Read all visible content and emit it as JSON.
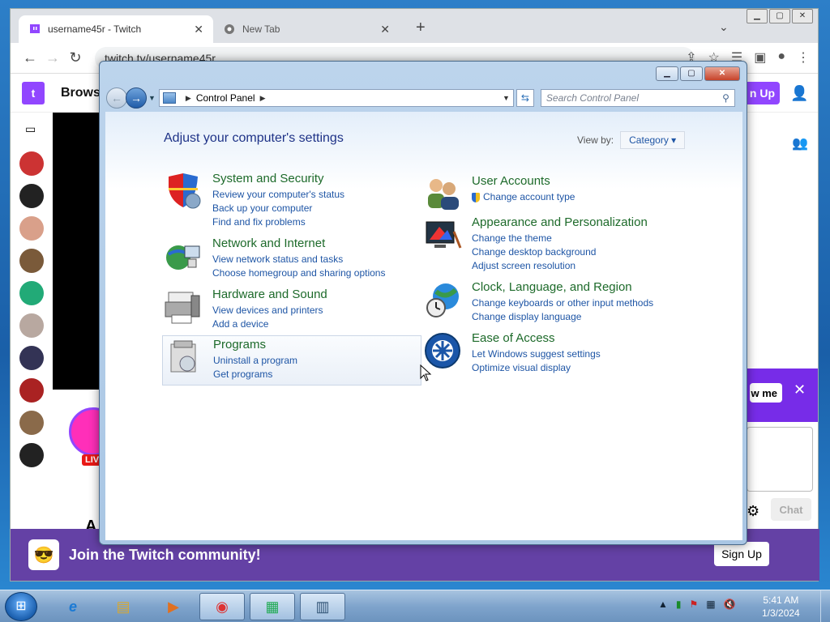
{
  "chrome": {
    "tabs": [
      {
        "title": "username45r - Twitch",
        "close": "✕"
      },
      {
        "title": "New Tab",
        "close": "✕"
      }
    ],
    "new_tab": "+",
    "tab_dropdown": "⌄",
    "window_controls": {
      "minimize": "▁",
      "maximize": "▢",
      "close": "✕"
    },
    "url": "twitch.tv/username45r",
    "toolbar": {
      "back": "←",
      "forward": "→",
      "reload": "↻",
      "share": "⇪",
      "star": "☆",
      "reading": "☰",
      "sidebar": "▣",
      "profile": "●",
      "menu": "⋮"
    }
  },
  "twitch": {
    "logo": "t",
    "browse": "Browse",
    "sign_up_top": "n Up",
    "follow_btn": "w me",
    "close_banner": "✕",
    "live_badge": "LIV",
    "chat_button": "Chat",
    "partial_text": "A",
    "join_text": "Join the Twitch community!",
    "sign_up_bottom": "Sign Up"
  },
  "control_panel": {
    "window_controls": {
      "minimize": "▁",
      "maximize": "▢",
      "close": "✕"
    },
    "address_label": "Control Panel",
    "search_placeholder": "Search Control Panel",
    "heading": "Adjust your computer's settings",
    "view_by_label": "View by:",
    "view_by_value": "Category",
    "categories_left": [
      {
        "title": "System and Security",
        "links": [
          "Review your computer's status",
          "Back up your computer",
          "Find and fix problems"
        ],
        "icon": "shield-icon"
      },
      {
        "title": "Network and Internet",
        "links": [
          "View network status and tasks",
          "Choose homegroup and sharing options"
        ],
        "icon": "network-globe-icon"
      },
      {
        "title": "Hardware and Sound",
        "links": [
          "View devices and printers",
          "Add a device"
        ],
        "icon": "printer-icon"
      },
      {
        "title": "Programs",
        "links": [
          "Uninstall a program",
          "Get programs"
        ],
        "icon": "programs-box-icon"
      }
    ],
    "categories_right": [
      {
        "title": "User Accounts",
        "links": [
          "Change account type"
        ],
        "icon": "users-icon"
      },
      {
        "title": "Appearance and Personalization",
        "links": [
          "Change the theme",
          "Change desktop background",
          "Adjust screen resolution"
        ],
        "icon": "monitor-paint-icon"
      },
      {
        "title": "Clock, Language, and Region",
        "links": [
          "Change keyboards or other input methods",
          "Change display language"
        ],
        "icon": "clock-globe-icon"
      },
      {
        "title": "Ease of Access",
        "links": [
          "Let Windows suggest settings",
          "Optimize visual display"
        ],
        "icon": "ease-of-access-icon"
      }
    ]
  },
  "taskbar": {
    "start": "⊞",
    "apps": [
      {
        "name": "internet-explorer",
        "glyph": "e"
      },
      {
        "name": "file-explorer",
        "glyph": "▤"
      },
      {
        "name": "media-player",
        "glyph": "▶"
      },
      {
        "name": "chrome",
        "glyph": "◉"
      },
      {
        "name": "task-manager",
        "glyph": "▦"
      },
      {
        "name": "control-panel",
        "glyph": "▥"
      }
    ],
    "tray_icons": [
      "▲",
      "▮",
      "⚑",
      "▦",
      "🔇"
    ],
    "time": "5:41 AM",
    "date": "1/3/2024"
  },
  "colors": {
    "twitch_purple": "#9146ff",
    "cp_link": "#1e55a5",
    "cp_title": "#1d6a2a",
    "cp_heading": "#1e3287"
  }
}
